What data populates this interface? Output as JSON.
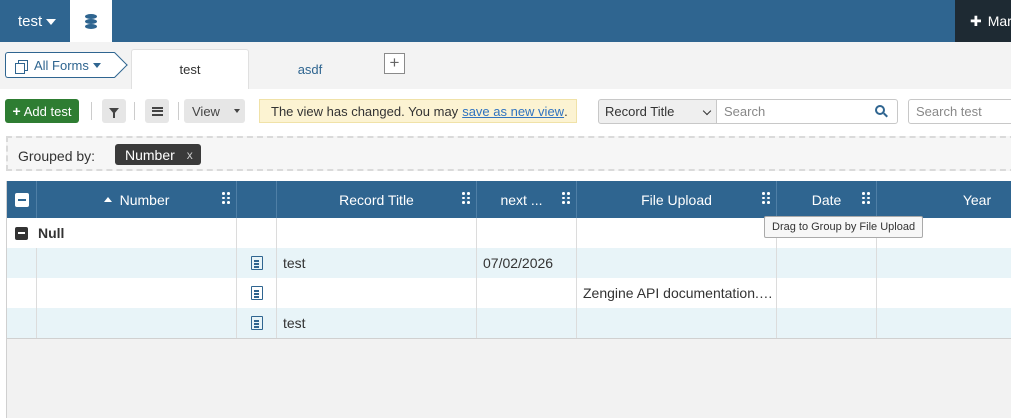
{
  "topbar": {
    "workspace_name": "test",
    "marketplace_label": "Marketplace"
  },
  "tabs": {
    "all_forms_label": "All Forms",
    "items": [
      {
        "label": "test",
        "active": true
      },
      {
        "label": "asdf",
        "active": false
      }
    ],
    "add_symbol": "+"
  },
  "toolbar": {
    "add_label": "Add test",
    "add_symbol": "+",
    "view_label": "View",
    "notice_text": "The view has changed. You may",
    "notice_link": "save as new view",
    "notice_end": ".",
    "field_select_value": "Record Title",
    "search_placeholder": "Search",
    "search2_placeholder": "Search test"
  },
  "grouping": {
    "label": "Grouped by:",
    "chip_label": "Number",
    "chip_remove": "x"
  },
  "grid": {
    "columns": [
      "Number",
      "",
      "Record Title",
      "next ...",
      "File Upload",
      "Date",
      "Year"
    ],
    "group_name": "Null",
    "rows": [
      {
        "record_title": "test",
        "next": "07/02/2026",
        "file_upload": ""
      },
      {
        "record_title": "",
        "next": "",
        "file_upload": "Zengine API documentation.pdf"
      },
      {
        "record_title": "test",
        "next": "",
        "file_upload": ""
      }
    ]
  },
  "tooltip": "Drag to Group by File Upload",
  "colors": {
    "brand": "#2f6590",
    "add_button": "#2e7d32",
    "row_tint": "#e8f4f8"
  }
}
